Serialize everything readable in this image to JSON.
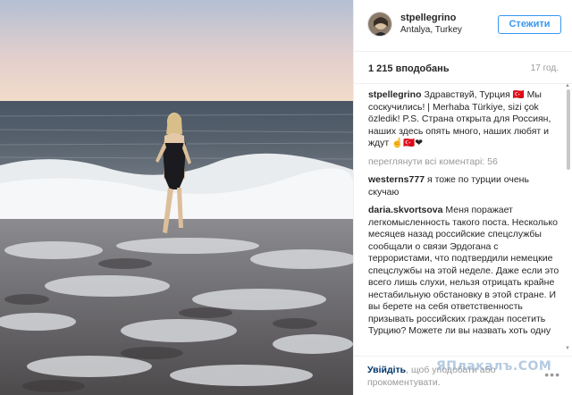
{
  "post": {
    "username": "stpellegrino",
    "location": "Antalya, Turkey",
    "follow_label": "Стежити",
    "likes": "1 215 вподобань",
    "time": "17 год."
  },
  "comments": [
    {
      "user": "stpellegrino",
      "text": "Здравствуй, Турция 🇹🇷 Мы соскучились! | Merhaba Türkiye, sizi çok özledik! P.S. Страна открыта для Россиян, наших здесь опять много, наших любят и ждут ☝️🇹🇷❤"
    },
    {
      "user": "westerns777",
      "text": "я тоже по турции очень скучаю"
    },
    {
      "user": "daria.skvortsova",
      "text": "Меня поражает легкомысленность такого поста. Несколько месяцев назад российские спецслужбы сообщали о связи Эрдогана с террористами, что подтвердили немецкие спецслужбы на этой неделе. Даже если это всего лишь слухи, нельзя отрицать крайне нестабильную обстановку в этой стране. И вы берете на себя ответственность призывать российских граждан посетить Турцию? Можете ли вы назвать хоть одну"
    }
  ],
  "more_comments": "переглянути всі коментарі: 56",
  "footer": {
    "login_link": "Увійдіть",
    "login_rest": ", щоб уподобати або прокоментувати.",
    "more_icon": "ellipsis-icon"
  },
  "watermark": "ЯПлакалъ.COM"
}
